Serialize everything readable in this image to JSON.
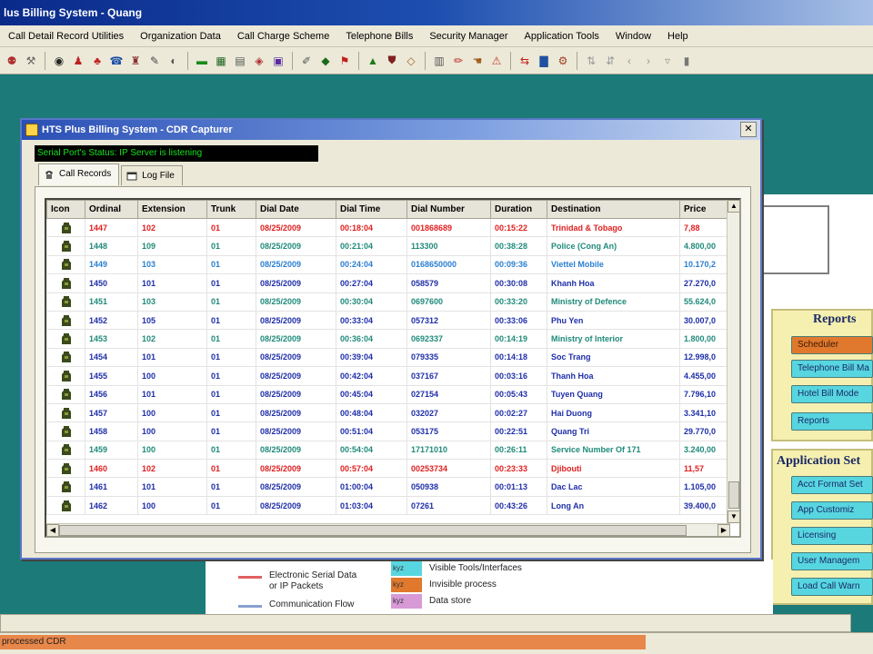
{
  "app": {
    "title": "lus Billing System - Quang"
  },
  "menu": [
    "Call Detail Record Utilities",
    "Organization Data",
    "Call Charge Scheme",
    "Telephone Bills",
    "Security Manager",
    "Application Tools",
    "Window",
    "Help"
  ],
  "colors": {
    "desktop": "#1c7a78",
    "row_red": "#e02020",
    "row_teal": "#1f8a7a",
    "row_blue": "#1f2fa8",
    "row_lightblue": "#2a7fd0",
    "status_green": "#16e21f",
    "accent_orange": "#e0792e",
    "panel_yellow": "#f6f0b0",
    "button_cyan": "#57d6e0"
  },
  "cdr_window": {
    "title": "HTS Plus Billing System - CDR Capturer",
    "close_glyph": "✕",
    "status_text": "Serial Port's Status: IP Server is listening",
    "tabs": [
      {
        "label": "Call Records",
        "icon": "phone-icon",
        "active": true
      },
      {
        "label": "Log File",
        "icon": "log-file-icon",
        "active": false
      }
    ],
    "grid": {
      "columns": [
        "Icon",
        "Ordinal",
        "Extension",
        "Trunk",
        "Dial Date",
        "Dial Time",
        "Dial Number",
        "Duration",
        "Destination",
        "Price"
      ],
      "rows": [
        {
          "color": "red",
          "ordinal": "1447",
          "extension": "102",
          "trunk": "01",
          "date": "08/25/2009",
          "time": "00:18:04",
          "number": "001868689",
          "duration": "00:15:22",
          "destination": "Trinidad & Tobago",
          "price": "7,88"
        },
        {
          "color": "teal",
          "ordinal": "1448",
          "extension": "109",
          "trunk": "01",
          "date": "08/25/2009",
          "time": "00:21:04",
          "number": "113300",
          "duration": "00:38:28",
          "destination": "Police (Cong An)",
          "price": "4.800,00"
        },
        {
          "color": "lightblue",
          "ordinal": "1449",
          "extension": "103",
          "trunk": "01",
          "date": "08/25/2009",
          "time": "00:24:04",
          "number": "0168650000",
          "duration": "00:09:36",
          "destination": "Viettel Mobile",
          "price": "10.170,2"
        },
        {
          "color": "blue",
          "ordinal": "1450",
          "extension": "101",
          "trunk": "01",
          "date": "08/25/2009",
          "time": "00:27:04",
          "number": "058579",
          "duration": "00:30:08",
          "destination": "Khanh Hoa",
          "price": "27.270,0"
        },
        {
          "color": "teal",
          "ordinal": "1451",
          "extension": "103",
          "trunk": "01",
          "date": "08/25/2009",
          "time": "00:30:04",
          "number": "0697600",
          "duration": "00:33:20",
          "destination": "Ministry of Defence",
          "price": "55.624,0"
        },
        {
          "color": "blue",
          "ordinal": "1452",
          "extension": "105",
          "trunk": "01",
          "date": "08/25/2009",
          "time": "00:33:04",
          "number": "057312",
          "duration": "00:33:06",
          "destination": "Phu Yen",
          "price": "30.007,0"
        },
        {
          "color": "teal",
          "ordinal": "1453",
          "extension": "102",
          "trunk": "01",
          "date": "08/25/2009",
          "time": "00:36:04",
          "number": "0692337",
          "duration": "00:14:19",
          "destination": "Ministry of Interior",
          "price": "1.800,00"
        },
        {
          "color": "blue",
          "ordinal": "1454",
          "extension": "101",
          "trunk": "01",
          "date": "08/25/2009",
          "time": "00:39:04",
          "number": "079335",
          "duration": "00:14:18",
          "destination": "Soc Trang",
          "price": "12.998,0"
        },
        {
          "color": "blue",
          "ordinal": "1455",
          "extension": "100",
          "trunk": "01",
          "date": "08/25/2009",
          "time": "00:42:04",
          "number": "037167",
          "duration": "00:03:16",
          "destination": "Thanh Hoa",
          "price": "4.455,00"
        },
        {
          "color": "blue",
          "ordinal": "1456",
          "extension": "101",
          "trunk": "01",
          "date": "08/25/2009",
          "time": "00:45:04",
          "number": "027154",
          "duration": "00:05:43",
          "destination": "Tuyen Quang",
          "price": "7.796,10"
        },
        {
          "color": "blue",
          "ordinal": "1457",
          "extension": "100",
          "trunk": "01",
          "date": "08/25/2009",
          "time": "00:48:04",
          "number": "032027",
          "duration": "00:02:27",
          "destination": "Hai Duong",
          "price": "3.341,10"
        },
        {
          "color": "blue",
          "ordinal": "1458",
          "extension": "100",
          "trunk": "01",
          "date": "08/25/2009",
          "time": "00:51:04",
          "number": "053175",
          "duration": "00:22:51",
          "destination": "Quang Tri",
          "price": "29.770,0"
        },
        {
          "color": "teal",
          "ordinal": "1459",
          "extension": "100",
          "trunk": "01",
          "date": "08/25/2009",
          "time": "00:54:04",
          "number": "17171010",
          "duration": "00:26:11",
          "destination": "Service Number Of 171",
          "price": "3.240,00"
        },
        {
          "color": "red",
          "ordinal": "1460",
          "extension": "102",
          "trunk": "01",
          "date": "08/25/2009",
          "time": "00:57:04",
          "number": "00253734",
          "duration": "00:23:33",
          "destination": "Djibouti",
          "price": "11,57"
        },
        {
          "color": "blue",
          "ordinal": "1461",
          "extension": "101",
          "trunk": "01",
          "date": "08/25/2009",
          "time": "01:00:04",
          "number": "050938",
          "duration": "00:01:13",
          "destination": "Dac Lac",
          "price": "1.105,00"
        },
        {
          "color": "blue",
          "ordinal": "1462",
          "extension": "100",
          "trunk": "01",
          "date": "08/25/2009",
          "time": "01:03:04",
          "number": "07261",
          "duration": "00:43:26",
          "destination": "Long An",
          "price": "39.400,0"
        }
      ]
    }
  },
  "reports_panel": {
    "title": "Reports",
    "buttons": [
      "Scheduler",
      "Telephone Bill Ma",
      "Hotel Bill Mode",
      "Reports"
    ]
  },
  "appsetup_panel": {
    "title": "Application Set",
    "buttons": [
      "Acct Format Set",
      "App Customiz",
      "Licensing",
      "User Managem",
      "Load Call Warn"
    ]
  },
  "legend": {
    "items": [
      {
        "label": "Electronic Serial Data\nor IP Packets"
      },
      {
        "label": "Communication Flow"
      }
    ],
    "swatches": [
      {
        "tag": "kyz",
        "label": "Visible Tools/Interfaces"
      },
      {
        "tag": "kyz",
        "label": "Invisible process"
      },
      {
        "tag": "kyz",
        "label": "Data store"
      }
    ]
  },
  "statusbar": {
    "text": "processed CDR",
    "progress": 0.74
  }
}
